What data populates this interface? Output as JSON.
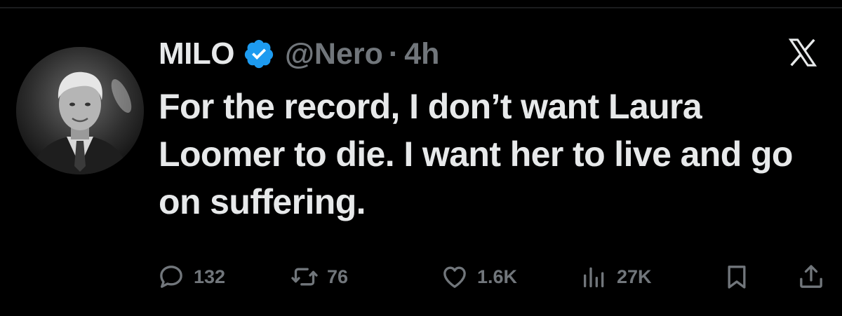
{
  "post": {
    "display_name": "MILO",
    "handle": "@Nero",
    "separator": "·",
    "timestamp": "4h",
    "verified": true,
    "text": "For the record, I don’t want Laura Loomer to die. I want her to live and go on suffering."
  },
  "actions": {
    "replies": "132",
    "reposts": "76",
    "likes": "1.6K",
    "views": "27K"
  },
  "icons": {
    "verified": "verified-badge-icon",
    "platform": "x-logo-icon",
    "reply": "reply-icon",
    "repost": "repost-icon",
    "like": "heart-icon",
    "views": "views-icon",
    "bookmark": "bookmark-icon",
    "share": "share-icon"
  },
  "colors": {
    "background": "#000000",
    "primary_text": "#e7e9ea",
    "secondary_text": "#71767b",
    "verified_blue": "#1d9bf0"
  }
}
